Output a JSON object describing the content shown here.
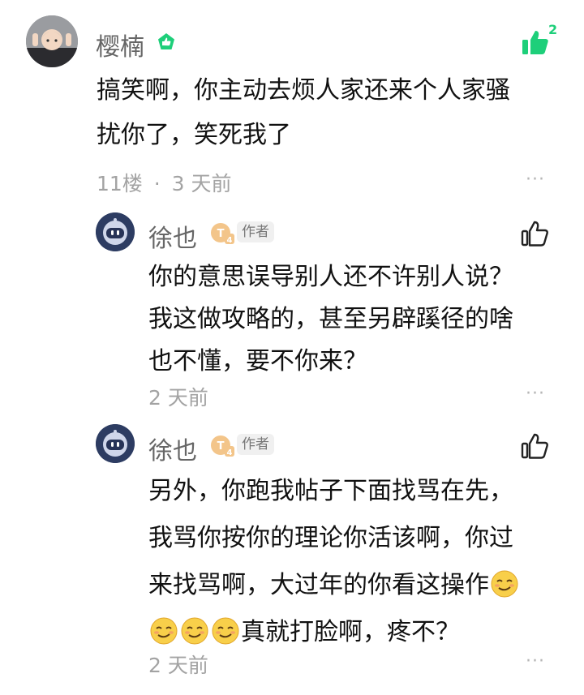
{
  "comment": {
    "username": "樱楠",
    "text_lines": [
      "搞笑啊，你主动去烦人家还来个人家骚",
      "扰你了，笑死我了"
    ],
    "floor": "11楼",
    "separator": "·",
    "time": "3 天前",
    "like_count": "2",
    "user_badge_icon": "verified-green-badge",
    "colors": {
      "like_active": "#1ecf7a"
    }
  },
  "replies": [
    {
      "username": "徐也",
      "author_tag": "作者",
      "level_badge": "T4",
      "text_lines": [
        "你的意思误导别人还不许别人说？",
        "我这做攻略的，甚至另辟蹊径的啥",
        "也不懂，要不你来？"
      ],
      "time": "2 天前"
    },
    {
      "username": "徐也",
      "author_tag": "作者",
      "level_badge": "T4",
      "text_lines": [
        "另外，你跑我帖子下面找骂在先，",
        "我骂你按你的理论你活该啊，你过",
        "来找骂啊，大过年的你看这操作",
        "真就打脸啊，疼不？"
      ],
      "time": "2 天前"
    }
  ],
  "more_label": "···"
}
